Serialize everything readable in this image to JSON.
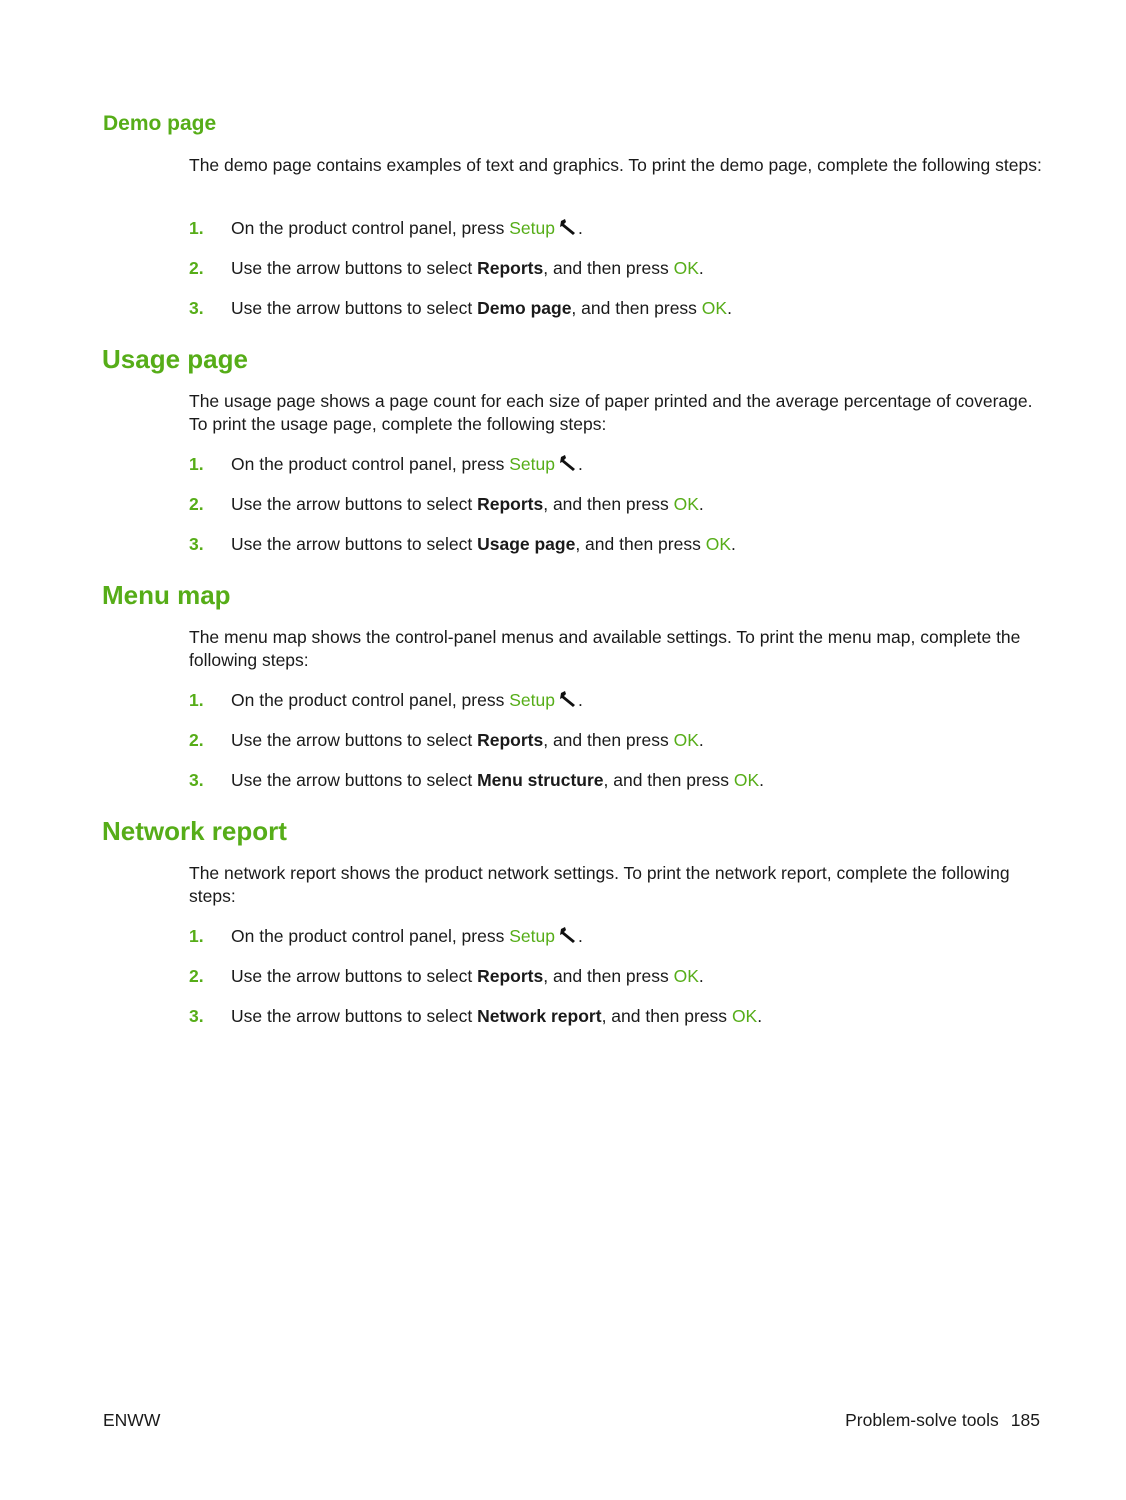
{
  "colors": {
    "accent": "#56ad18",
    "text": "#1a1a1a"
  },
  "sections": [
    {
      "heading": "Demo page",
      "intro": "The demo page contains examples of text and graphics. To print the demo page, complete the following steps:",
      "steps": [
        {
          "num": "1.",
          "pre": "On the product control panel, press ",
          "button": "Setup",
          "icon": "wrench-icon",
          "post": "."
        },
        {
          "num": "2.",
          "pre": "Use the arrow buttons to select ",
          "bold": "Reports",
          "mid": ", and then press ",
          "button": "OK",
          "post": "."
        },
        {
          "num": "3.",
          "pre": "Use the arrow buttons to select ",
          "bold": "Demo page",
          "mid": ", and then press ",
          "button": "OK",
          "post": "."
        }
      ]
    },
    {
      "heading": "Usage page",
      "intro": "The usage page shows a page count for each size of paper printed and the average percentage of coverage. To print the usage page, complete the following steps:",
      "steps": [
        {
          "num": "1.",
          "pre": "On the product control panel, press ",
          "button": "Setup",
          "icon": "wrench-icon",
          "post": "."
        },
        {
          "num": "2.",
          "pre": "Use the arrow buttons to select ",
          "bold": "Reports",
          "mid": ", and then press ",
          "button": "OK",
          "post": "."
        },
        {
          "num": "3.",
          "pre": "Use the arrow buttons to select ",
          "bold": "Usage page",
          "mid": ", and then press ",
          "button": "OK",
          "post": "."
        }
      ]
    },
    {
      "heading": "Menu map",
      "intro": "The menu map shows the control-panel menus and available settings. To print the menu map, complete the following steps:",
      "steps": [
        {
          "num": "1.",
          "pre": "On the product control panel, press ",
          "button": "Setup",
          "icon": "wrench-icon",
          "post": "."
        },
        {
          "num": "2.",
          "pre": "Use the arrow buttons to select ",
          "bold": "Reports",
          "mid": ", and then press ",
          "button": "OK",
          "post": "."
        },
        {
          "num": "3.",
          "pre": "Use the arrow buttons to select ",
          "bold": "Menu structure",
          "mid": ", and then press ",
          "button": "OK",
          "post": "."
        }
      ]
    },
    {
      "heading": "Network report",
      "intro": "The network report shows the product network settings. To print the network report, complete the following steps:",
      "steps": [
        {
          "num": "1.",
          "pre": "On the product control panel, press ",
          "button": "Setup",
          "icon": "wrench-icon",
          "post": "."
        },
        {
          "num": "2.",
          "pre": "Use the arrow buttons to select ",
          "bold": "Reports",
          "mid": ", and then press ",
          "button": "OK",
          "post": "."
        },
        {
          "num": "3.",
          "pre": "Use the arrow buttons to select ",
          "bold": "Network report",
          "mid": ", and then press ",
          "button": "OK",
          "post": "."
        }
      ]
    }
  ],
  "footer": {
    "left": "ENWW",
    "section_title": "Problem-solve tools",
    "page_number": "185"
  }
}
